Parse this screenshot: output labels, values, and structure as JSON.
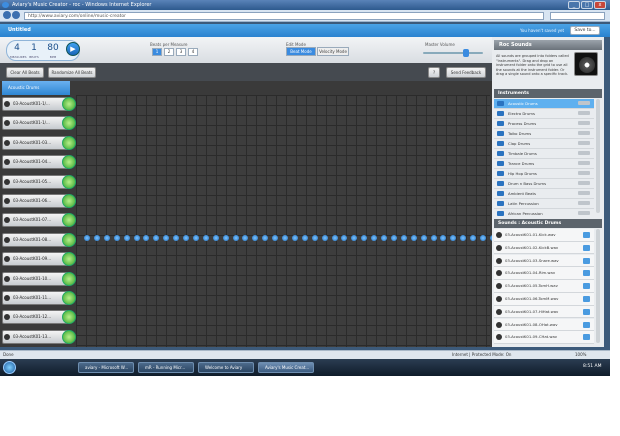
{
  "window": {
    "title": "Aviary's Music Creator - roc - Windows Internet Explorer",
    "url": "http://www.aviary.com/online/music-creator"
  },
  "app": {
    "doc_title": "Untitled",
    "user_text": "You haven't saved yet",
    "save_label": "Save to..."
  },
  "tempo": {
    "d1": "4",
    "d1_label": "MEASURES",
    "d2": "1",
    "d2_label": "BEATS",
    "d3": "80",
    "d3_label": "BPM"
  },
  "controls": {
    "beats_label": "Beats per Measure",
    "beats": [
      "1",
      "2",
      "3",
      "4"
    ],
    "edit_mode_label": "Edit Mode",
    "modes": [
      "Beat Mode",
      "Velocity Mode"
    ],
    "volume_label": "Master Volume",
    "volume_level": 0.7
  },
  "toolbar": {
    "clear": "Clear All Beats",
    "randomize": "Randomize All Beats",
    "help": "?",
    "feedback": "Send Feedback"
  },
  "tracks": {
    "header": "Acoustic Drums",
    "items": [
      "03-AcoustK01-1/...",
      "03-AcoustK01-1/...",
      "03-AcoustK01-03...",
      "03-AcoustK01-04...",
      "03-AcoustK01-05...",
      "03-AcoustK01-06...",
      "03-AcoustK01-07...",
      "03-AcoustK01-08...",
      "03-AcoustK01-09...",
      "03-AcoustK01-10...",
      "03-AcoustK01-11...",
      "03-AcoustK01-12...",
      "03-AcoustK01-13..."
    ],
    "active_row": 7
  },
  "roc": {
    "title": "Roc Sounds",
    "desc": "All sounds are grouped into folders called \"instruments\". Drag and drop an instrument folder onto the grid to use all the sounds at the instrument folder. Or drag a single sound onto a specific track.",
    "thumb_label": "Roc Sounds"
  },
  "instruments": {
    "title": "Instruments",
    "items": [
      "Acoustic Drums",
      "Electro Drums",
      "Process Drums",
      "Taiko Drums",
      "Clap Drums",
      "Timbale Drums",
      "Trance Drums",
      "Hip Hop Drums",
      "Drum n Bass Drums",
      "Ambient Beats",
      "Latin Percussion",
      "African Percussion"
    ]
  },
  "sounds": {
    "title": "Sounds : Acoustic Drums",
    "items": [
      "03-AcoustK01-01-Kick.wav",
      "03-AcoustK01-02-KickB.wav",
      "03-AcoustK01-03-Snare.wav",
      "03-AcoustK01-04-Rim.wav",
      "03-AcoustK01-05-TomH.wav",
      "03-AcoustK01-06-TomM.wav",
      "03-AcoustK01-07-HiHat.wav",
      "03-AcoustK01-08-OHat.wav",
      "03-AcoustK01-09-CHat.wav"
    ]
  },
  "status": {
    "left": "Done",
    "zone": "Internet | Protected Mode: On",
    "zoom": "100%"
  },
  "taskbar": {
    "items": [
      "aviary - Microsoft W...",
      "mR - Running Micr...",
      "Welcome to Aviary",
      "Aviary's Music Creat..."
    ],
    "clock": "8:51 AM"
  },
  "colors": {
    "accent": "#2a82cf",
    "beat": "#1f6fc0",
    "knob": "#35a52a"
  }
}
